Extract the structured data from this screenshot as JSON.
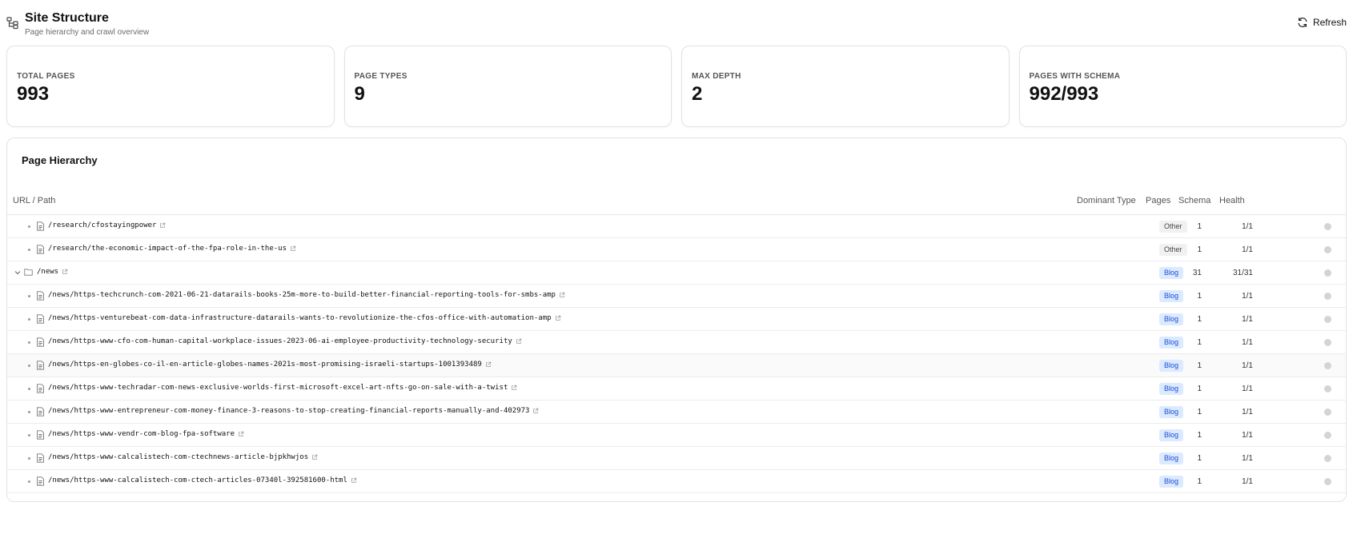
{
  "header": {
    "title": "Site Structure",
    "subtitle": "Page hierarchy and crawl overview",
    "refresh_label": "Refresh"
  },
  "stats": [
    {
      "label": "TOTAL PAGES",
      "value": "993"
    },
    {
      "label": "PAGE TYPES",
      "value": "9"
    },
    {
      "label": "MAX DEPTH",
      "value": "2"
    },
    {
      "label": "PAGES WITH SCHEMA",
      "value": "992/993"
    }
  ],
  "hierarchy": {
    "title": "Page Hierarchy",
    "columns": {
      "path": "URL / Path",
      "type": "Dominant Type",
      "pages": "Pages",
      "schema": "Schema",
      "health": "Health"
    },
    "rows": [
      {
        "path": "/research/cfostayingpower",
        "type": "Other",
        "pages": "1",
        "schema": "1/1"
      },
      {
        "path": "/research/the-economic-impact-of-the-fpa-role-in-the-us",
        "type": "Other",
        "pages": "1",
        "schema": "1/1"
      },
      {
        "path": "/news",
        "type": "Blog",
        "pages": "31",
        "schema": "31/31"
      },
      {
        "path": "/news/https-techcrunch-com-2021-06-21-datarails-books-25m-more-to-build-better-financial-reporting-tools-for-smbs-amp",
        "type": "Blog",
        "pages": "1",
        "schema": "1/1"
      },
      {
        "path": "/news/https-venturebeat-com-data-infrastructure-datarails-wants-to-revolutionize-the-cfos-office-with-automation-amp",
        "type": "Blog",
        "pages": "1",
        "schema": "1/1"
      },
      {
        "path": "/news/https-www-cfo-com-human-capital-workplace-issues-2023-06-ai-employee-productivity-technology-security",
        "type": "Blog",
        "pages": "1",
        "schema": "1/1"
      },
      {
        "path": "/news/https-en-globes-co-il-en-article-globes-names-2021s-most-promising-israeli-startups-1001393489",
        "type": "Blog",
        "pages": "1",
        "schema": "1/1"
      },
      {
        "path": "/news/https-www-techradar-com-news-exclusive-worlds-first-microsoft-excel-art-nfts-go-on-sale-with-a-twist",
        "type": "Blog",
        "pages": "1",
        "schema": "1/1"
      },
      {
        "path": "/news/https-www-entrepreneur-com-money-finance-3-reasons-to-stop-creating-financial-reports-manually-and-402973",
        "type": "Blog",
        "pages": "1",
        "schema": "1/1"
      },
      {
        "path": "/news/https-www-vendr-com-blog-fpa-software",
        "type": "Blog",
        "pages": "1",
        "schema": "1/1"
      },
      {
        "path": "/news/https-www-calcalistech-com-ctechnews-article-bjpkhwjos",
        "type": "Blog",
        "pages": "1",
        "schema": "1/1"
      },
      {
        "path": "/news/https-www-calcalistech-com-ctech-articles-07340l-392581600-html",
        "type": "Blog",
        "pages": "1",
        "schema": "1/1"
      }
    ]
  }
}
